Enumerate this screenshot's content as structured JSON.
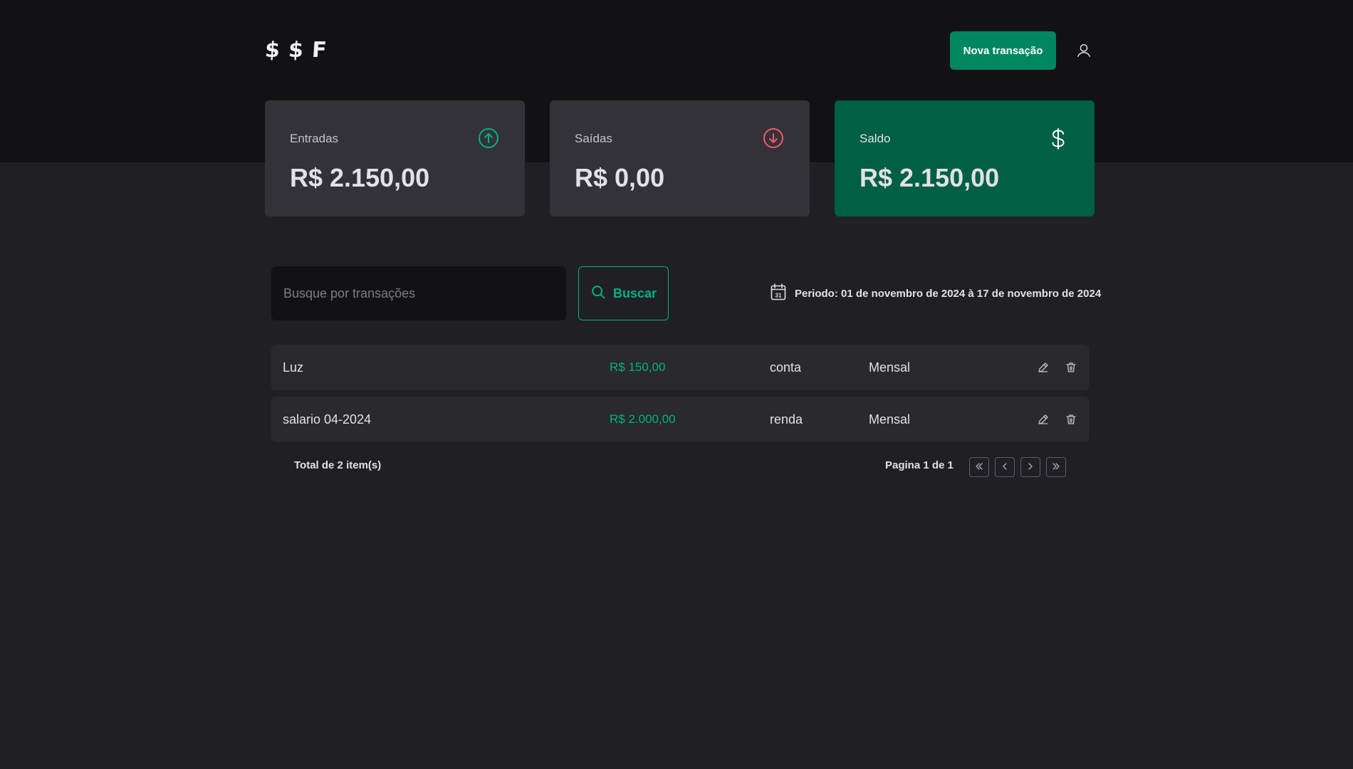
{
  "header": {
    "logo": [
      "$",
      "$",
      "F"
    ],
    "new_transaction_label": "Nova transação",
    "user_icon": "user-icon"
  },
  "summary": [
    {
      "title": "Entradas",
      "value": "R$ 2.150,00",
      "icon": "arrow-circle-up-icon",
      "icon_color": "#00b37e"
    },
    {
      "title": "Saídas",
      "value": "R$ 0,00",
      "icon": "arrow-circle-down-icon",
      "icon_color": "#f75a68"
    },
    {
      "title": "Saldo",
      "value": "R$ 2.150,00",
      "icon": "currency-dollar-icon",
      "icon_color": "#ffffff"
    }
  ],
  "search": {
    "placeholder": "Busque por transações",
    "value": "",
    "button_label": "Buscar"
  },
  "period": {
    "label": "Periodo: 01 de novembro de 2024 à 17 de novembro de 2024",
    "icon": "calendar-icon",
    "icon_day": "31"
  },
  "transactions": [
    {
      "description": "Luz",
      "price": "R$ 150,00",
      "category": "conta",
      "recurrence": "Mensal"
    },
    {
      "description": "salario 04-2024",
      "price": "R$ 2.000,00",
      "category": "renda",
      "recurrence": "Mensal"
    }
  ],
  "footer": {
    "total": "Total de 2 item(s)",
    "page_info": "Pagina 1 de 1"
  },
  "colors": {
    "background": "#202024",
    "header_background": "#121214",
    "card": "#323238",
    "card_highlight": "#015f43",
    "accent": "#00875f",
    "income": "#00b37e",
    "outcome": "#f75a68"
  }
}
